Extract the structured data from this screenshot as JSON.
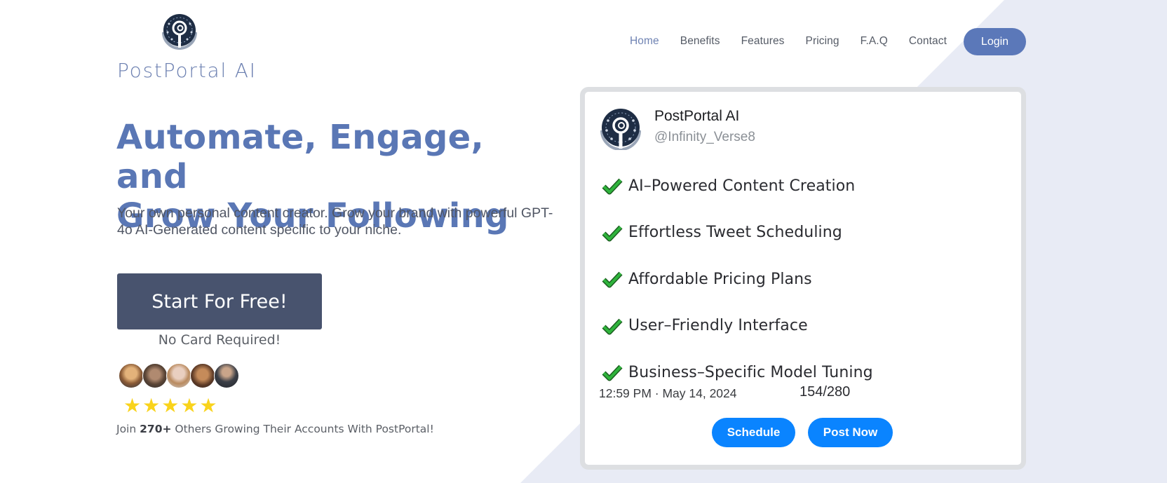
{
  "brand": {
    "name": "PostPortal AI",
    "logo_icon": "portal-logo-icon"
  },
  "nav": {
    "items": [
      {
        "label": "Home",
        "active": true
      },
      {
        "label": "Benefits",
        "active": false
      },
      {
        "label": "Features",
        "active": false
      },
      {
        "label": "Pricing",
        "active": false
      },
      {
        "label": "F.A.Q",
        "active": false
      },
      {
        "label": "Contact",
        "active": false
      }
    ],
    "login_label": "Login"
  },
  "hero": {
    "title_line1": "Automate, Engage, and",
    "title_line2": "Grow Your Following",
    "subtitle": "Your own personal content creator. Grow your brand with powerful GPT-4o AI-Generated content specific to your niche.",
    "cta_label": "Start For Free!",
    "cta_note": "No Card Required!",
    "rating_stars": 5,
    "rating_max": 5,
    "join_prefix": "Join ",
    "join_count": "270+",
    "join_suffix": " Others Growing Their Accounts With PostPortal!",
    "avatars": [
      "avatar-1",
      "avatar-2",
      "avatar-3",
      "avatar-4",
      "avatar-5"
    ]
  },
  "card": {
    "account_name": "PostPortal AI",
    "handle": "@Infinity_Verse8",
    "features": [
      "AI–Powered Content Creation",
      "Effortless Tweet Scheduling",
      "Affordable Pricing Plans",
      "User–Friendly Interface",
      "Business–Specific Model Tuning"
    ],
    "timestamp": "12:59 PM · May 14, 2024",
    "char_count": "154/280",
    "schedule_label": "Schedule",
    "post_now_label": "Post Now"
  },
  "colors": {
    "accent": "#5a77b5",
    "login_bg": "#5b78b9",
    "cta_bg": "#48536e",
    "tweet_button": "#0a84ff",
    "check_green": "#22a834",
    "star": "#f9d31c",
    "diagonal_bg": "#e8ebf5"
  }
}
